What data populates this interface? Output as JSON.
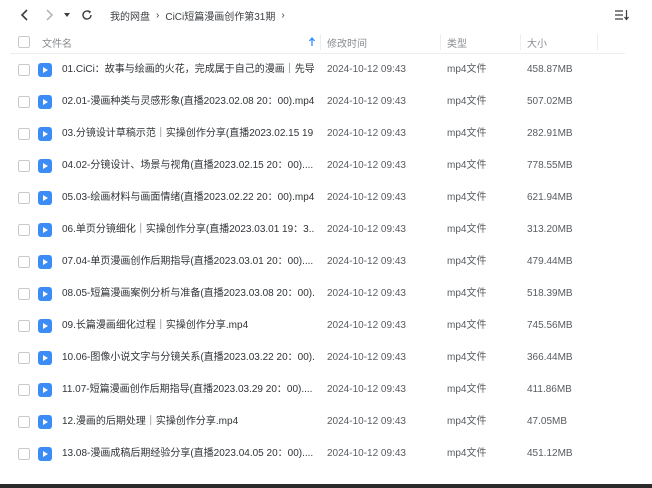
{
  "toolbar": {
    "breadcrumb": [
      "我的网盘",
      "CiCi短篇漫画创作第31期"
    ]
  },
  "header": {
    "name": "文件名",
    "modified": "修改时间",
    "type": "类型",
    "size": "大小"
  },
  "files": [
    {
      "name": "01.CiCi：故事与绘画的火花，完成属于自己的漫画｜先导...",
      "date": "2024-10-12 09:43",
      "type": "mp4文件",
      "size": "458.87MB"
    },
    {
      "name": "02.01-漫画种类与灵感形象(直播2023.02.08 20：00).mp4",
      "date": "2024-10-12 09:43",
      "type": "mp4文件",
      "size": "507.02MB"
    },
    {
      "name": "03.分镜设计草稿示范｜实操创作分享(直播2023.02.15 19...",
      "date": "2024-10-12 09:43",
      "type": "mp4文件",
      "size": "282.91MB"
    },
    {
      "name": "04.02-分镜设计、场景与视角(直播2023.02.15 20：00)....",
      "date": "2024-10-12 09:43",
      "type": "mp4文件",
      "size": "778.55MB"
    },
    {
      "name": "05.03-绘画材料与画面情绪(直播2023.02.22 20：00).mp4",
      "date": "2024-10-12 09:43",
      "type": "mp4文件",
      "size": "621.94MB"
    },
    {
      "name": "06.单页分镜细化｜实操创作分享(直播2023.03.01 19：3...",
      "date": "2024-10-12 09:43",
      "type": "mp4文件",
      "size": "313.20MB"
    },
    {
      "name": "07.04-单页漫画创作后期指导(直播2023.03.01 20：00)....",
      "date": "2024-10-12 09:43",
      "type": "mp4文件",
      "size": "479.44MB"
    },
    {
      "name": "08.05-短篇漫画案例分析与准备(直播2023.03.08 20：00)...",
      "date": "2024-10-12 09:43",
      "type": "mp4文件",
      "size": "518.39MB"
    },
    {
      "name": "09.长篇漫画细化过程｜实操创作分享.mp4",
      "date": "2024-10-12 09:43",
      "type": "mp4文件",
      "size": "745.56MB"
    },
    {
      "name": "10.06-图像小说文字与分镜关系(直播2023.03.22 20：00)....",
      "date": "2024-10-12 09:43",
      "type": "mp4文件",
      "size": "366.44MB"
    },
    {
      "name": "11.07-短篇漫画创作后期指导(直播2023.03.29 20：00)....",
      "date": "2024-10-12 09:43",
      "type": "mp4文件",
      "size": "411.86MB"
    },
    {
      "name": "12.漫画的后期处理｜实操创作分享.mp4",
      "date": "2024-10-12 09:43",
      "type": "mp4文件",
      "size": "47.05MB"
    },
    {
      "name": "13.08-漫画成稿后期经验分享(直播2023.04.05 20：00)....",
      "date": "2024-10-12 09:43",
      "type": "mp4文件",
      "size": "451.12MB"
    }
  ],
  "colors": {
    "accent": "#2f8cff",
    "file_icon": "#3c8cf5"
  }
}
